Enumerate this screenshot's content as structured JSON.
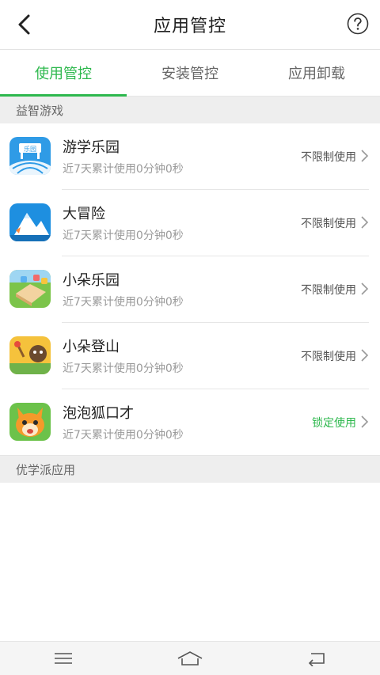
{
  "header": {
    "title": "应用管控"
  },
  "tabs": [
    {
      "label": "使用管控",
      "active": true
    },
    {
      "label": "安装管控",
      "active": false
    },
    {
      "label": "应用卸载",
      "active": false
    }
  ],
  "sections": {
    "games": "益智游戏",
    "apps": "优学派应用"
  },
  "apps": [
    {
      "name": "游学乐园",
      "usage": "近7天累计使用0分钟0秒",
      "status": "不限制使用",
      "icon_text": "乐园"
    },
    {
      "name": "大冒险",
      "usage": "近7天累计使用0分钟0秒",
      "status": "不限制使用"
    },
    {
      "name": "小朵乐园",
      "usage": "近7天累计使用0分钟0秒",
      "status": "不限制使用"
    },
    {
      "name": "小朵登山",
      "usage": "近7天累计使用0分钟0秒",
      "status": "不限制使用"
    },
    {
      "name": "泡泡狐口才",
      "usage": "近7天累计使用0分钟0秒",
      "status": "锁定使用"
    }
  ],
  "colors": {
    "accent": "#2db84d",
    "section_bg": "#eeeeee"
  }
}
